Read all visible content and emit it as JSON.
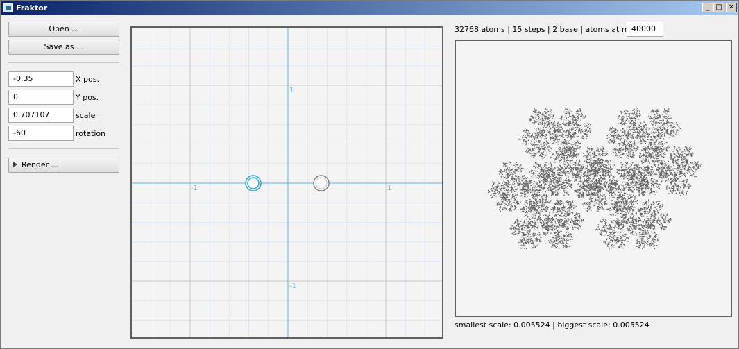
{
  "window": {
    "title": "Fraktor",
    "min_label": "_",
    "max_label": "□",
    "close_label": "✕"
  },
  "controls": {
    "open_label": "Open ...",
    "save_label": "Save as ...",
    "fields": [
      {
        "value": "-0.35",
        "label": "X pos."
      },
      {
        "value": "0",
        "label": "Y pos."
      },
      {
        "value": "0.707107",
        "label": "scale"
      },
      {
        "value": "-60",
        "label": "rotation"
      }
    ],
    "render_label": "Render ..."
  },
  "editor": {
    "axis_labels": {
      "x_neg": "-1",
      "x_pos": "1",
      "y_pos": "1",
      "y_neg": "-1"
    },
    "colors": {
      "grid_minor": "#dde6f4",
      "grid_major": "#c8c8c8",
      "axis": "#5fb6e8",
      "selected": "#29a3dd",
      "handle": "#808080"
    }
  },
  "info": {
    "stats": "32768 atoms | 15 steps | 2 base | atoms at most:",
    "max_atoms": "40000",
    "scales": "smallest scale: 0.005524 | biggest scale: 0.005524"
  },
  "preview": {
    "fractal_color": "#666666"
  }
}
